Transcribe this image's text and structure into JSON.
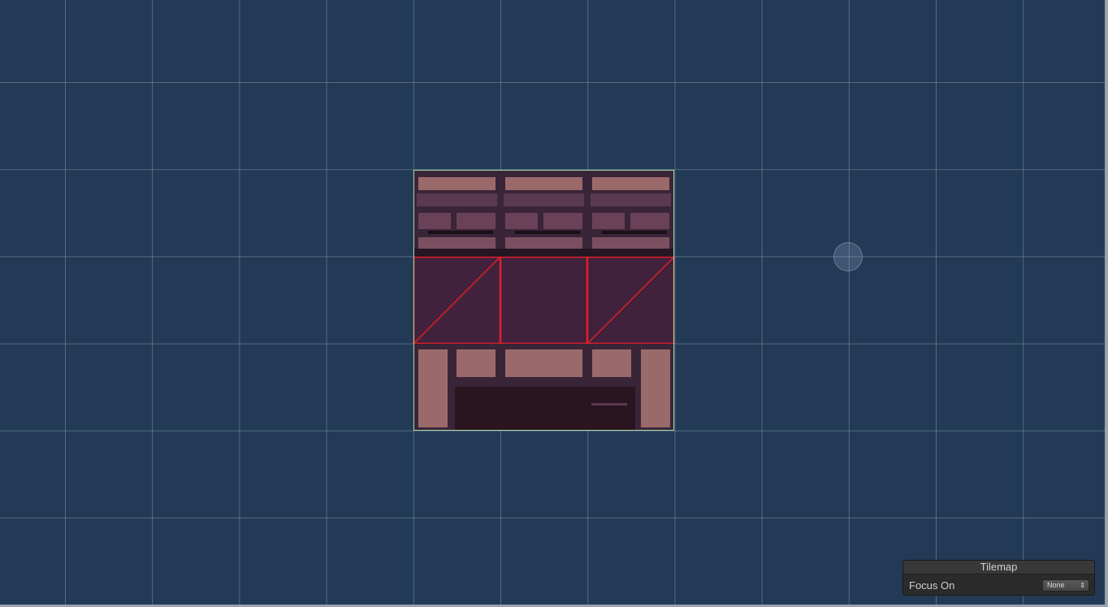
{
  "scene": {
    "background": "#223a55",
    "grid_color": "#7f93ad",
    "selection_color": "#a8d8a0",
    "collider_color": "#e0202a"
  },
  "tilemap_panel": {
    "title": "Tilemap",
    "focus_label": "Focus On",
    "focus_value": "None",
    "select_icon": "up-down-arrows-icon"
  }
}
